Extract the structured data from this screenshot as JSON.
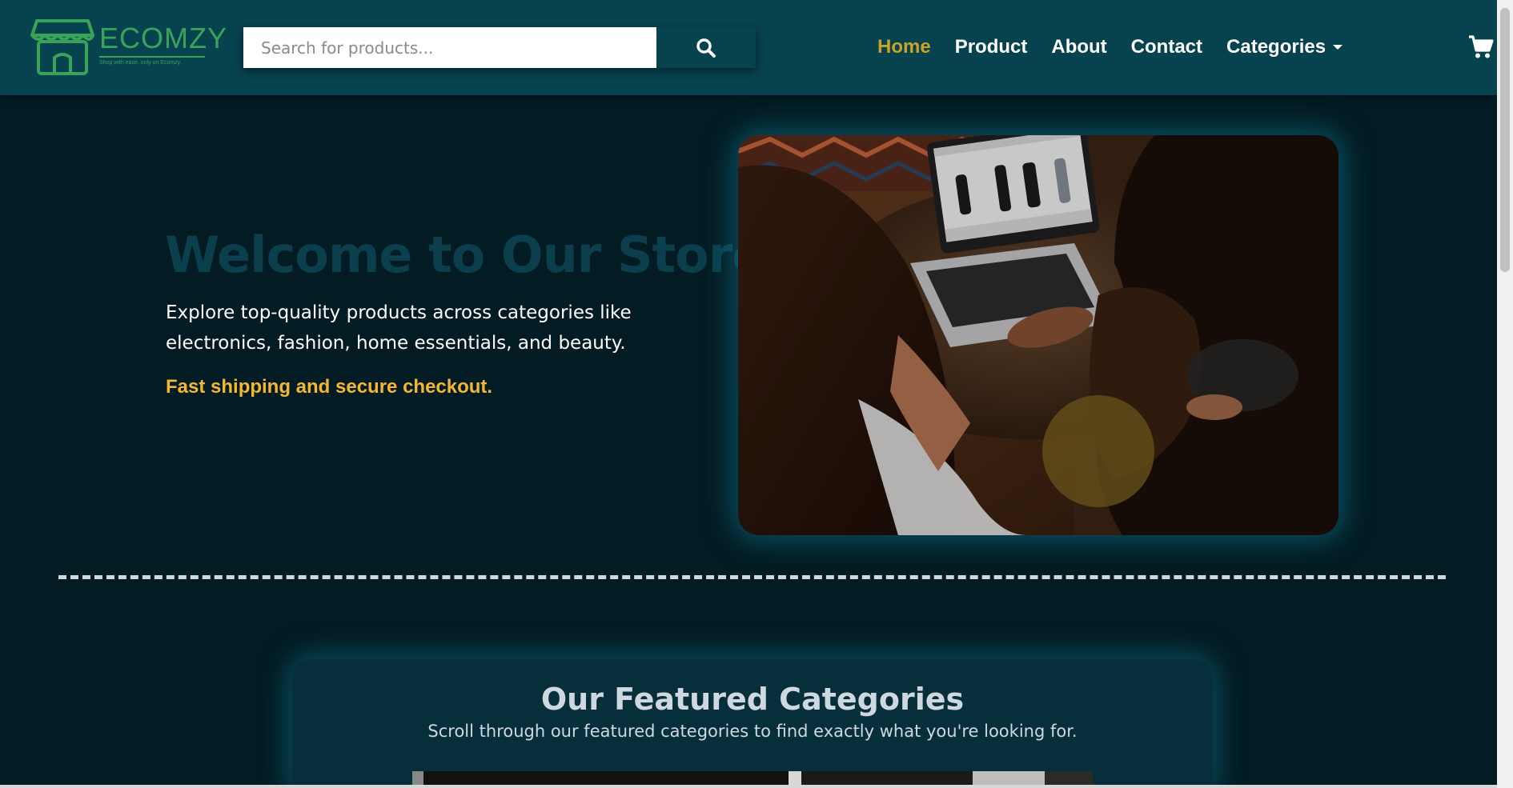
{
  "header": {
    "logo": {
      "text": "ECOMZY",
      "tagline": "Shop with ease, only on Ecomzy."
    },
    "search": {
      "placeholder": "Search for products..."
    },
    "nav": [
      {
        "label": "Home",
        "active": true
      },
      {
        "label": "Product",
        "active": false
      },
      {
        "label": "About",
        "active": false
      },
      {
        "label": "Contact",
        "active": false
      },
      {
        "label": "Categories",
        "active": false,
        "has_dropdown": true
      }
    ],
    "icons": {
      "search": "search-icon",
      "cart": "shopping-cart-icon",
      "dropdown": "caret-down-icon",
      "logo": "storefront-icon"
    }
  },
  "hero": {
    "title": "Welcome to Our Store",
    "description": "Explore top-quality products across categories like electronics, fashion, home essentials, and beauty.",
    "highlight": "Fast shipping and secure checkout."
  },
  "featured": {
    "title": "Our Featured Categories",
    "subtitle": "Scroll through our featured categories to find exactly what you're looking for."
  },
  "colors": {
    "navbar": "#07424f",
    "page_background": "#031b22",
    "accent_gold": "#f5b731",
    "active_nav": "#c9a227",
    "logo_green": "#3aa35a",
    "title_muted": "#0b3f4d"
  }
}
